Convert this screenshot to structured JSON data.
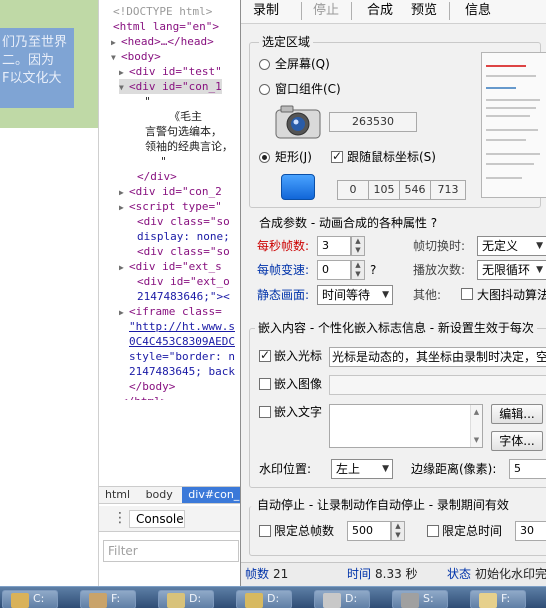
{
  "webpage": {
    "lines": [
      "们乃至世界",
      "二。因为",
      "F以文化大"
    ]
  },
  "devtools": {
    "lines": [
      {
        "text": "<!DOCTYPE html>",
        "cls": "gry",
        "indent": 0,
        "tri": ""
      },
      {
        "text": "<html lang=\"en\">",
        "cls": "",
        "indent": 0,
        "tri": ""
      },
      {
        "text": "<head>…</head>",
        "cls": "",
        "indent": 1,
        "tri": "▶"
      },
      {
        "text": "<body>",
        "cls": "",
        "indent": 1,
        "tri": "▼"
      },
      {
        "text": "<div id=\"test\"",
        "cls": "",
        "indent": 2,
        "tri": "▶"
      },
      {
        "text": "<div id=\"con_1",
        "cls": "hl",
        "indent": 2,
        "tri": "▼"
      },
      {
        "text": "\"",
        "cls": "txt",
        "indent": 4,
        "tri": ""
      },
      {
        "text": "《毛主",
        "cls": "txt",
        "indent": 7,
        "tri": ""
      },
      {
        "text": "言警句选编本，",
        "cls": "txt",
        "indent": 4,
        "tri": ""
      },
      {
        "text": "领袖的经典言论，",
        "cls": "txt",
        "indent": 4,
        "tri": ""
      },
      {
        "text": "\"",
        "cls": "txt",
        "indent": 6,
        "tri": ""
      },
      {
        "text": "</div>",
        "cls": "",
        "indent": 3,
        "tri": ""
      },
      {
        "text": "<div id=\"con_2",
        "cls": "",
        "indent": 2,
        "tri": "▶"
      },
      {
        "text": "<script type=\"",
        "cls": "",
        "indent": 2,
        "tri": "▶"
      },
      {
        "text": "<div class=\"so",
        "cls": "",
        "indent": 3,
        "tri": ""
      },
      {
        "text": "display: none;",
        "cls": "val",
        "indent": 3,
        "tri": ""
      },
      {
        "text": "<div class=\"so",
        "cls": "",
        "indent": 3,
        "tri": ""
      },
      {
        "text": "<div id=\"ext_s",
        "cls": "",
        "indent": 2,
        "tri": "▶"
      },
      {
        "text": "<div id=\"ext_o",
        "cls": "",
        "indent": 3,
        "tri": ""
      },
      {
        "text": "2147483646;\"><",
        "cls": "val",
        "indent": 3,
        "tri": ""
      },
      {
        "text": "<iframe class=",
        "cls": "",
        "indent": 2,
        "tri": "▶"
      },
      {
        "text": "\"http://ht.www.s",
        "cls": "link",
        "indent": 2,
        "tri": ""
      },
      {
        "text": "0C4C453C8309AEDC",
        "cls": "link",
        "indent": 2,
        "tri": ""
      },
      {
        "text": "style=\"border: n",
        "cls": "val",
        "indent": 2,
        "tri": ""
      },
      {
        "text": "2147483645; back",
        "cls": "val",
        "indent": 2,
        "tri": ""
      },
      {
        "text": "</body>",
        "cls": "",
        "indent": 2,
        "tri": ""
      },
      {
        "text": "</html>",
        "cls": "",
        "indent": 1,
        "tri": ""
      }
    ],
    "breadcrumbs": [
      "html",
      "body",
      "div#con_1"
    ],
    "console_tab": "Console",
    "filter_placeholder": "Filter"
  },
  "recorder": {
    "toolbar": {
      "record": "录制",
      "stop": "停止",
      "compose": "合成",
      "preview": "预览",
      "info": "信息"
    },
    "region": {
      "title": "选定区域",
      "fullscreen": "全屏幕(Q)",
      "window": "窗口组件(C)",
      "window_handle": "263530",
      "rect": "矩形(J)",
      "follow_mouse": "跟随鼠标坐标(S)",
      "coords": [
        "0",
        "105",
        "546",
        "713"
      ]
    },
    "compose": {
      "title": "合成参数 - 动画合成的各种属性 ?",
      "fps_label": "每秒帧数:",
      "fps_value": "3",
      "frame_switch_label": "帧切换时:",
      "frame_switch_value": "无定义",
      "speed_label": "每帧变速:",
      "speed_value": "0",
      "speed_hint": "?",
      "play_count_label": "播放次数:",
      "play_count_value": "无限循环",
      "static_label": "静态画面:",
      "static_value": "时间等待",
      "other_label": "其他:",
      "big_jitter": "大图抖动算法"
    },
    "embed": {
      "title": "嵌入内容 - 个性化嵌入标志信息 - 新设置生效于每次",
      "cursor": "嵌入光标",
      "cursor_text": "光标是动态的，其坐标由录制时决定，空",
      "image": "嵌入图像",
      "text": "嵌入文字",
      "edit_btn": "编辑...",
      "font_btn": "字体...",
      "watermark_label": "水印位置:",
      "watermark_value": "左上",
      "margin_label": "边缘距离(像素):",
      "margin_value": "5"
    },
    "autostop": {
      "title": "自动停止 - 让录制动作自动停止 - 录制期间有效",
      "limit_frames": "限定总帧数",
      "frames_value": "500",
      "limit_time": "限定总时间",
      "time_value": "30"
    },
    "status": {
      "frames_key": "帧数",
      "frames_val": "21",
      "time_key": "时间",
      "time_val": "8.33 秒",
      "state_key": "状态",
      "state_val": "初始化水印完"
    }
  },
  "taskbar": {
    "items": [
      {
        "label": "C:",
        "color": "#d9b25a"
      },
      {
        "label": "F:",
        "color": "#c9a36a"
      },
      {
        "label": "D:",
        "color": "#d8c27a"
      },
      {
        "label": "D:",
        "color": "#d7b960"
      },
      {
        "label": "D:",
        "color": "#c8c8c8"
      },
      {
        "label": "S:",
        "color": "#a0a0a0"
      },
      {
        "label": "F:",
        "color": "#e6d08c"
      }
    ]
  },
  "colors": {
    "accent": "#3b79d9",
    "label_red": "#cc0000",
    "label_blue": "#0033aa"
  }
}
